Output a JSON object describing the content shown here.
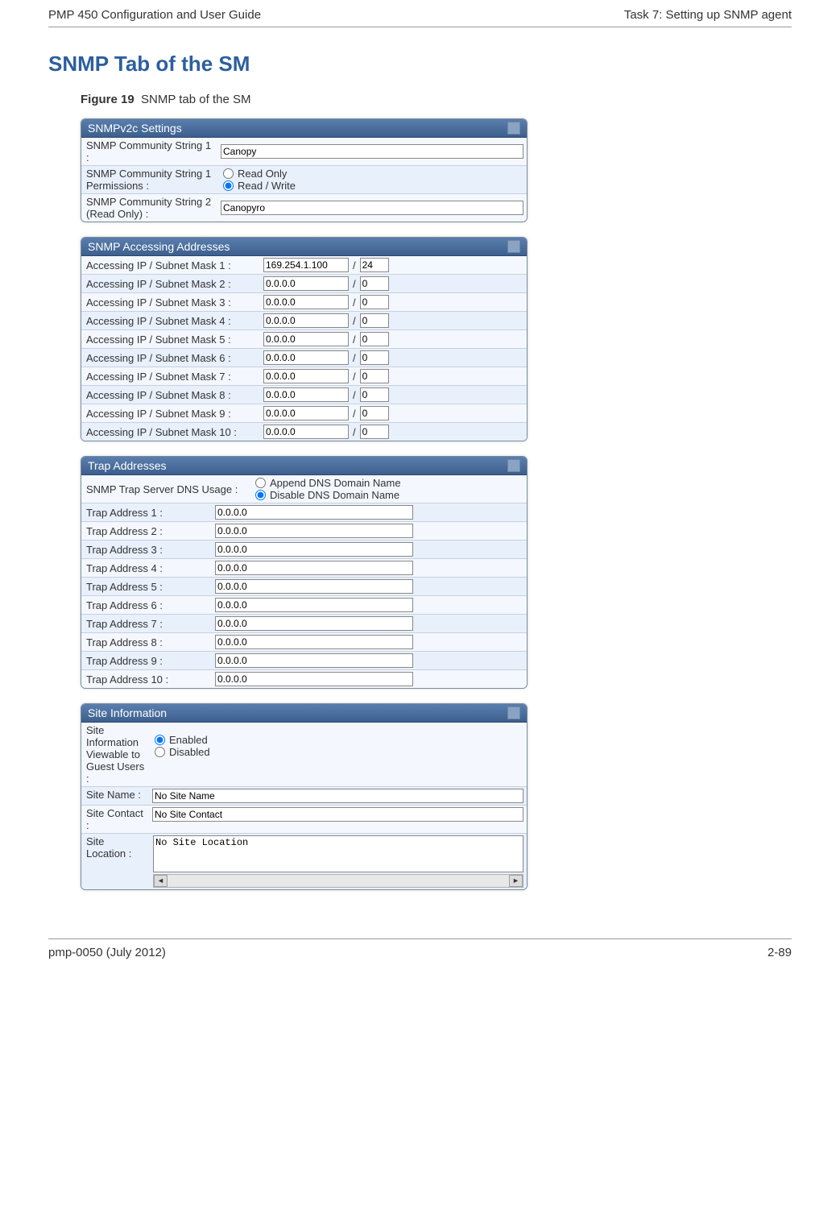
{
  "header": {
    "left": "PMP 450 Configuration and User Guide",
    "right": "Task 7: Setting up SNMP agent"
  },
  "section_title": "SNMP Tab of the SM",
  "figure_bold": "Figure 19",
  "figure_rest": "SNMP tab of the SM",
  "panels": {
    "snmpv2c": {
      "title": "SNMPv2c Settings",
      "rows": [
        {
          "label": "SNMP Community String 1 :",
          "value": "Canopy"
        },
        {
          "label": "SNMP Community String 1 Permissions :",
          "radios": [
            "Read Only",
            "Read / Write"
          ],
          "selected": 1
        },
        {
          "label": "SNMP Community String 2 (Read Only) :",
          "value": "Canopyro"
        }
      ]
    },
    "access": {
      "title": "SNMP Accessing Addresses",
      "rows": [
        {
          "label": "Accessing IP / Subnet Mask 1 :",
          "ip": "169.254.1.100",
          "mask": "24"
        },
        {
          "label": "Accessing IP / Subnet Mask 2 :",
          "ip": "0.0.0.0",
          "mask": "0"
        },
        {
          "label": "Accessing IP / Subnet Mask 3 :",
          "ip": "0.0.0.0",
          "mask": "0"
        },
        {
          "label": "Accessing IP / Subnet Mask 4 :",
          "ip": "0.0.0.0",
          "mask": "0"
        },
        {
          "label": "Accessing IP / Subnet Mask 5 :",
          "ip": "0.0.0.0",
          "mask": "0"
        },
        {
          "label": "Accessing IP / Subnet Mask 6 :",
          "ip": "0.0.0.0",
          "mask": "0"
        },
        {
          "label": "Accessing IP / Subnet Mask 7 :",
          "ip": "0.0.0.0",
          "mask": "0"
        },
        {
          "label": "Accessing IP / Subnet Mask 8 :",
          "ip": "0.0.0.0",
          "mask": "0"
        },
        {
          "label": "Accessing IP / Subnet Mask 9 :",
          "ip": "0.0.0.0",
          "mask": "0"
        },
        {
          "label": "Accessing IP / Subnet Mask 10 :",
          "ip": "0.0.0.0",
          "mask": "0"
        }
      ]
    },
    "trap": {
      "title": "Trap Addresses",
      "dns_label": "SNMP Trap Server DNS Usage :",
      "dns_radios": [
        "Append DNS Domain Name",
        "Disable DNS Domain Name"
      ],
      "dns_selected": 1,
      "rows": [
        {
          "label": "Trap Address 1 :",
          "value": "0.0.0.0"
        },
        {
          "label": "Trap Address 2 :",
          "value": "0.0.0.0"
        },
        {
          "label": "Trap Address 3 :",
          "value": "0.0.0.0"
        },
        {
          "label": "Trap Address 4 :",
          "value": "0.0.0.0"
        },
        {
          "label": "Trap Address 5 :",
          "value": "0.0.0.0"
        },
        {
          "label": "Trap Address 6 :",
          "value": "0.0.0.0"
        },
        {
          "label": "Trap Address 7 :",
          "value": "0.0.0.0"
        },
        {
          "label": "Trap Address 8 :",
          "value": "0.0.0.0"
        },
        {
          "label": "Trap Address 9 :",
          "value": "0.0.0.0"
        },
        {
          "label": "Trap Address 10 :",
          "value": "0.0.0.0"
        }
      ]
    },
    "site": {
      "title": "Site Information",
      "rows": [
        {
          "label": "Site Information Viewable to Guest Users :",
          "radios": [
            "Enabled",
            "Disabled"
          ],
          "selected": 0
        },
        {
          "label": "Site Name :",
          "value": "No Site Name"
        },
        {
          "label": "Site Contact :",
          "value": "No Site Contact"
        },
        {
          "label": "Site Location :",
          "textarea": "No Site Location"
        }
      ]
    }
  },
  "footer": {
    "left": "pmp-0050 (July 2012)",
    "right": "2-89"
  }
}
